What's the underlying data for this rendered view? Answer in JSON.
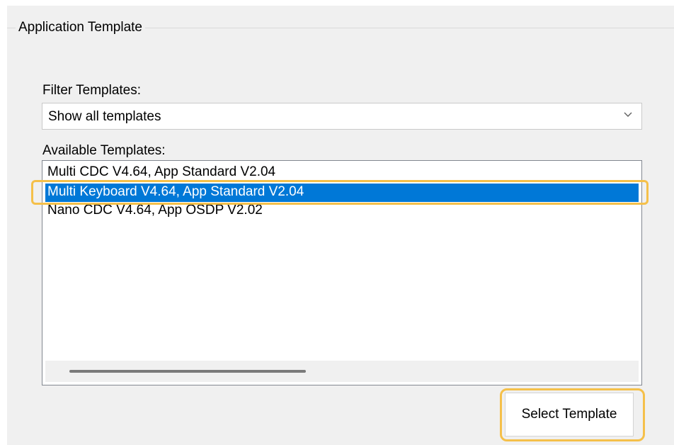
{
  "group": {
    "title": "Application Template"
  },
  "filter": {
    "label": "Filter Templates:",
    "selected": "Show all templates"
  },
  "templates": {
    "label": "Available Templates:",
    "items": [
      "Multi CDC V4.64, App Standard V2.04",
      "Multi Keyboard V4.64, App Standard V2.04",
      "Nano CDC V4.64, App OSDP V2.02"
    ],
    "selected_index": 1
  },
  "actions": {
    "select_label": "Select Template"
  },
  "colors": {
    "selection": "#0078d7",
    "highlight": "#f5c04a",
    "panel_bg": "#f0f0f0"
  }
}
